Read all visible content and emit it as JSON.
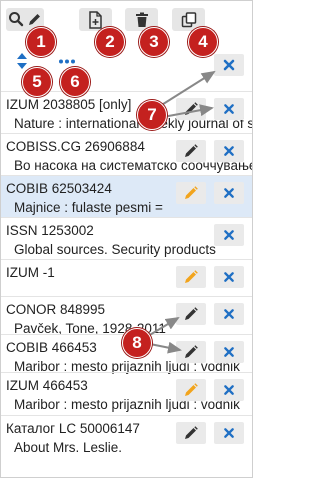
{
  "colors": {
    "x_blue": "#1f6fc4",
    "pencil_dark": "#333333",
    "pencil_orange": "#f2a41c",
    "badge_red": "#c4211f",
    "selected_bg": "#dde9f7"
  },
  "toolbar": {
    "search_icon": "search-icon",
    "edit_icon": "pencil-icon",
    "new_doc_icon": "new-document-icon",
    "delete_icon": "trash-icon",
    "copy_icon": "copy-icon",
    "sort_icon": "sort-icon",
    "more_icon": "more-icon"
  },
  "records": [
    {
      "id": "IZUM 2038805 [only]",
      "desc": "Nature : international weekly journal of science",
      "edit": "dark",
      "selected": false
    },
    {
      "id": "COBISS.CG 26906884",
      "desc": "Во насока на систематско сооччување",
      "edit": "dark",
      "selected": false
    },
    {
      "id": "COBIB 62503424",
      "desc": "Majnice : fulaste pesmi =",
      "edit": "orange",
      "selected": true
    },
    {
      "id": "ISSN 1253002",
      "desc": "Global sources. Security products",
      "edit": "none",
      "selected": false
    },
    {
      "id": "IZUM -1",
      "desc": "",
      "edit": "orange",
      "selected": false
    },
    {
      "id": "CONOR 848995",
      "desc": "Pavček, Tone, 1928-2011",
      "edit": "dark",
      "selected": false
    },
    {
      "id": "COBIB 466453",
      "desc": "Maribor : mesto prijaznih ljudi : vodnik",
      "edit": "dark",
      "selected": false
    },
    {
      "id": "IZUM 466453",
      "desc": "Maribor : mesto prijaznih ljudi : vodnik",
      "edit": "orange",
      "selected": false
    },
    {
      "id": "Каталог LC 50006147",
      "desc": "About Mrs. Leslie.",
      "edit": "dark",
      "selected": false
    }
  ],
  "callouts": [
    "1",
    "2",
    "3",
    "4",
    "5",
    "6",
    "7",
    "8"
  ]
}
